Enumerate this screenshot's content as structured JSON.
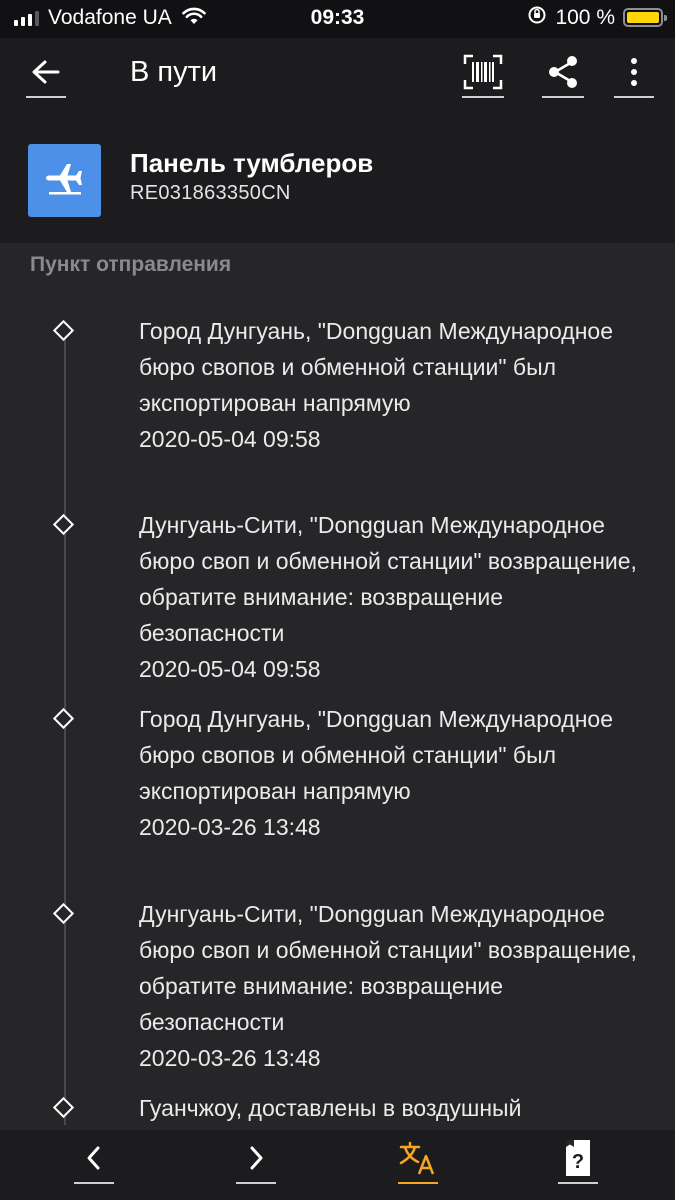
{
  "status_bar": {
    "carrier": "Vodafone UA",
    "time": "09:33",
    "battery_percent": "100 %",
    "battery_level": 1.0,
    "signal_bars": 3
  },
  "app_bar": {
    "title": "В пути"
  },
  "parcel": {
    "name": "Панель тумблеров",
    "tracking_code": "RE031863350CN"
  },
  "section": {
    "label": "Пункт отправления"
  },
  "events": [
    {
      "text": "Город Дунгуань, \"Dongguan Международное бюро свопов и обменной станции\" был экспортирован напрямую",
      "date": "2020-05-04 09:58"
    },
    {
      "text": "Дунгуань-Сити, \"Dongguan Международное бюро своп и обменной станции\" возвращение, обратите внимание: возвращение безопасности",
      "date": "2020-05-04 09:58"
    },
    {
      "text": "Город Дунгуань, \"Dongguan Международное бюро свопов и обменной станции\" был экспортирован напрямую",
      "date": "2020-03-26 13:48"
    },
    {
      "text": "Дунгуань-Сити, \"Dongguan Международное бюро своп и обменной станции\" возвращение, обратите внимание: возвращение безопасности",
      "date": "2020-03-26 13:48"
    },
    {
      "text": "Гуанчжоу, доставлены в воздушный",
      "date": ""
    }
  ],
  "colors": {
    "background": "#1c1c1e",
    "list_background": "#262628",
    "accent_blue": "#4d90e8",
    "accent_orange": "#f5a623",
    "battery_yellow": "#ffd60a"
  },
  "icons": {
    "back": "arrow-left-icon",
    "barcode": "barcode-scan-icon",
    "share": "share-icon",
    "more": "more-vertical-icon",
    "parcel_type": "airplane-icon",
    "prev": "chevron-left-icon",
    "next": "chevron-right-icon",
    "translate": "translate-icon",
    "help": "help-card-icon"
  }
}
